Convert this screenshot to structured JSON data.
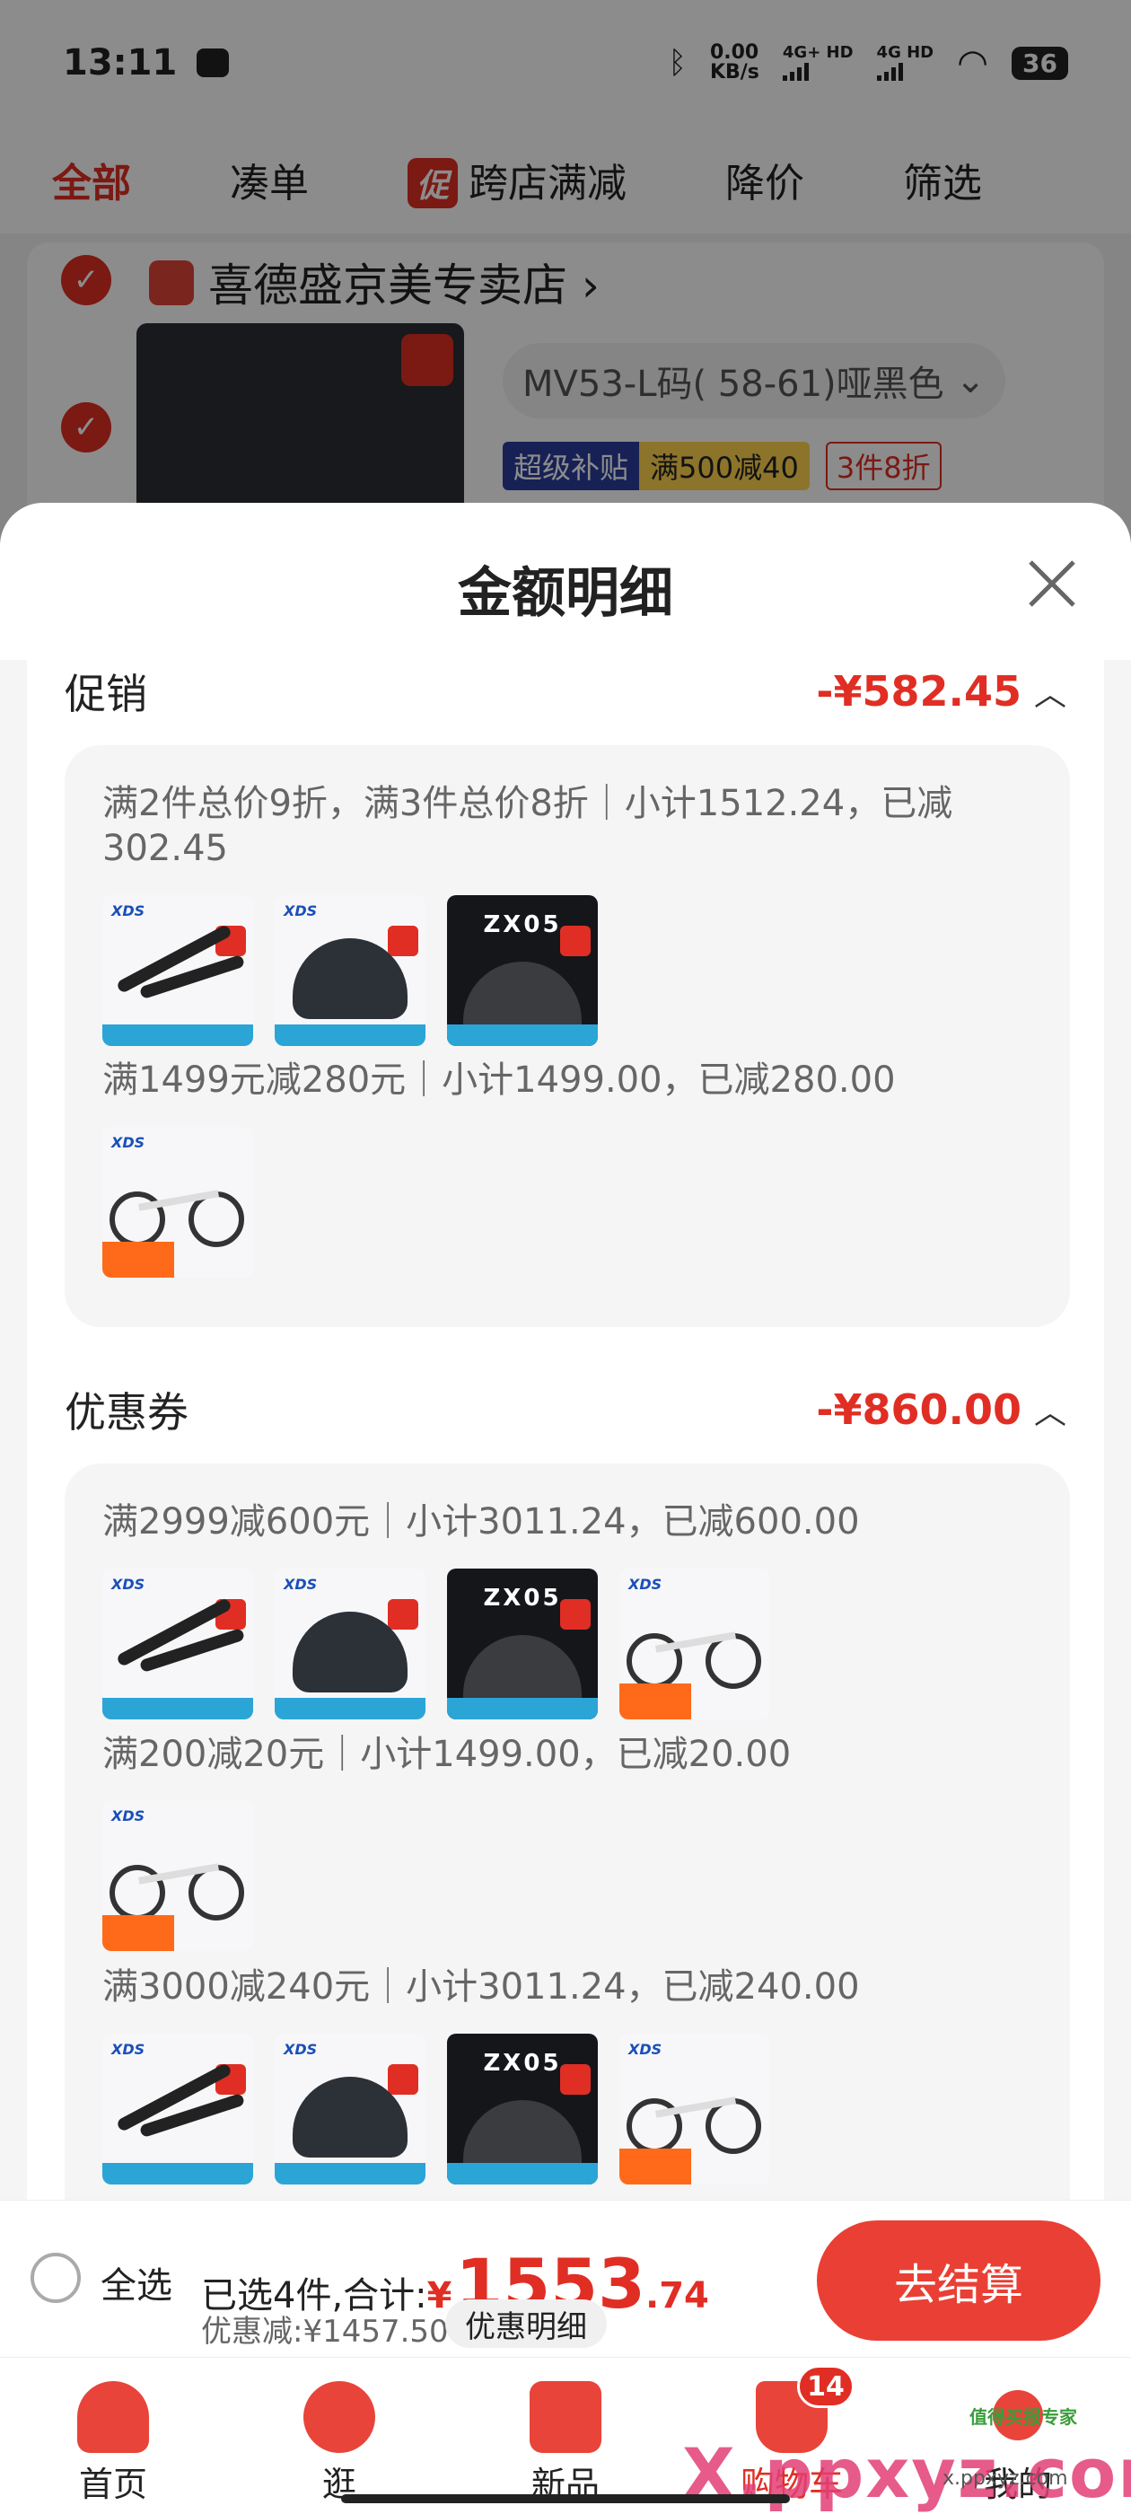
{
  "status_bar": {
    "time": "13:11",
    "net_speed_value": "0.00",
    "net_speed_unit": "KB/s",
    "sig1": "4G+ HD",
    "sig2": "4G HD",
    "battery": "36"
  },
  "tabs": [
    {
      "label": "全部"
    },
    {
      "label": "凑单"
    },
    {
      "badge": "促",
      "label": "跨店满减"
    },
    {
      "label": "降价"
    },
    {
      "label": "筛选"
    }
  ],
  "store": {
    "name": "喜德盛京美专卖店",
    "chevron": "›",
    "spec": "MV53-L码( 58-61)哑黑色",
    "badge_a": "超级补贴",
    "badge_b": "满500减40",
    "badge_c": "3件8折"
  },
  "sheet": {
    "title": "金额明细",
    "promo": {
      "title": "促销",
      "amount": "-¥582.45",
      "rule1_line1": "满2件总价9折，满3件总价8折｜小计1512.24，已减",
      "rule1_line2": "302.45",
      "rule2": "满1499元减280元｜小计1499.00，已减280.00"
    },
    "coupon": {
      "title": "优惠券",
      "amount": "-¥860.00",
      "rule1": "满2999减600元｜小计3011.24，已减600.00",
      "rule2": "满200减20元｜小计1499.00，已减20.00",
      "rule3": "满3000减240元｜小计3011.24，已减240.00"
    },
    "thumb_texts": {
      "brand": "XDS",
      "helmet_model": "ZX05"
    }
  },
  "bottom_bar": {
    "select_all": "全选",
    "selected_text": "已选4件,合计:",
    "currency": "¥",
    "total_int": "1553",
    "total_dec": ".74",
    "discount": "优惠减:¥1457.50",
    "detail_button": "优惠明细",
    "checkout": "去结算"
  },
  "nav": [
    {
      "label": "首页"
    },
    {
      "label": "逛"
    },
    {
      "label": "新品"
    },
    {
      "label": "购物车",
      "badge": "14"
    },
    {
      "label": "我的"
    }
  ],
  "watermark": {
    "text": "X.ppxyz.com",
    "small": "x.ppxyz.com",
    "top": "值得买报专家"
  },
  "colors": {
    "accent": "#e02e24",
    "checkout": "#ea3f34"
  }
}
